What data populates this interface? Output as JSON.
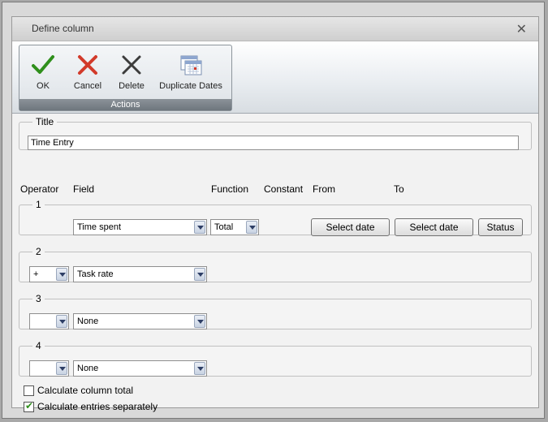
{
  "window": {
    "title": "Define column",
    "close_glyph": "✕"
  },
  "ribbon": {
    "group_caption": "Actions",
    "buttons": {
      "ok": "OK",
      "cancel": "Cancel",
      "delete": "Delete",
      "duplicate_dates": "Duplicate Dates"
    },
    "icons": {
      "ok": "checkmark-icon",
      "cancel": "x-cross-icon",
      "delete": "delete-x-icon",
      "duplicate_dates": "calendar-icon"
    }
  },
  "title_section": {
    "legend": "Title",
    "value": "Time Entry"
  },
  "columns": {
    "operator": "Operator",
    "field": "Field",
    "function": "Function",
    "constant": "Constant",
    "from": "From",
    "to": "To"
  },
  "rows": [
    {
      "number": "1",
      "field": "Time spent",
      "function": "Total",
      "from_button": "Select date",
      "to_button": "Select date",
      "status_button": "Status"
    },
    {
      "number": "2",
      "operator": "+",
      "field": "Task rate"
    },
    {
      "number": "3",
      "operator": "",
      "field": "None"
    },
    {
      "number": "4",
      "operator": "",
      "field": "None"
    }
  ],
  "options": {
    "calc_total": {
      "label": "Calculate column total",
      "checked": false
    },
    "calc_separately": {
      "label": "Calculate entries separately",
      "checked": true
    }
  },
  "colors": {
    "accept_green": "#2f8f1c",
    "cancel_red": "#d23a2a"
  }
}
